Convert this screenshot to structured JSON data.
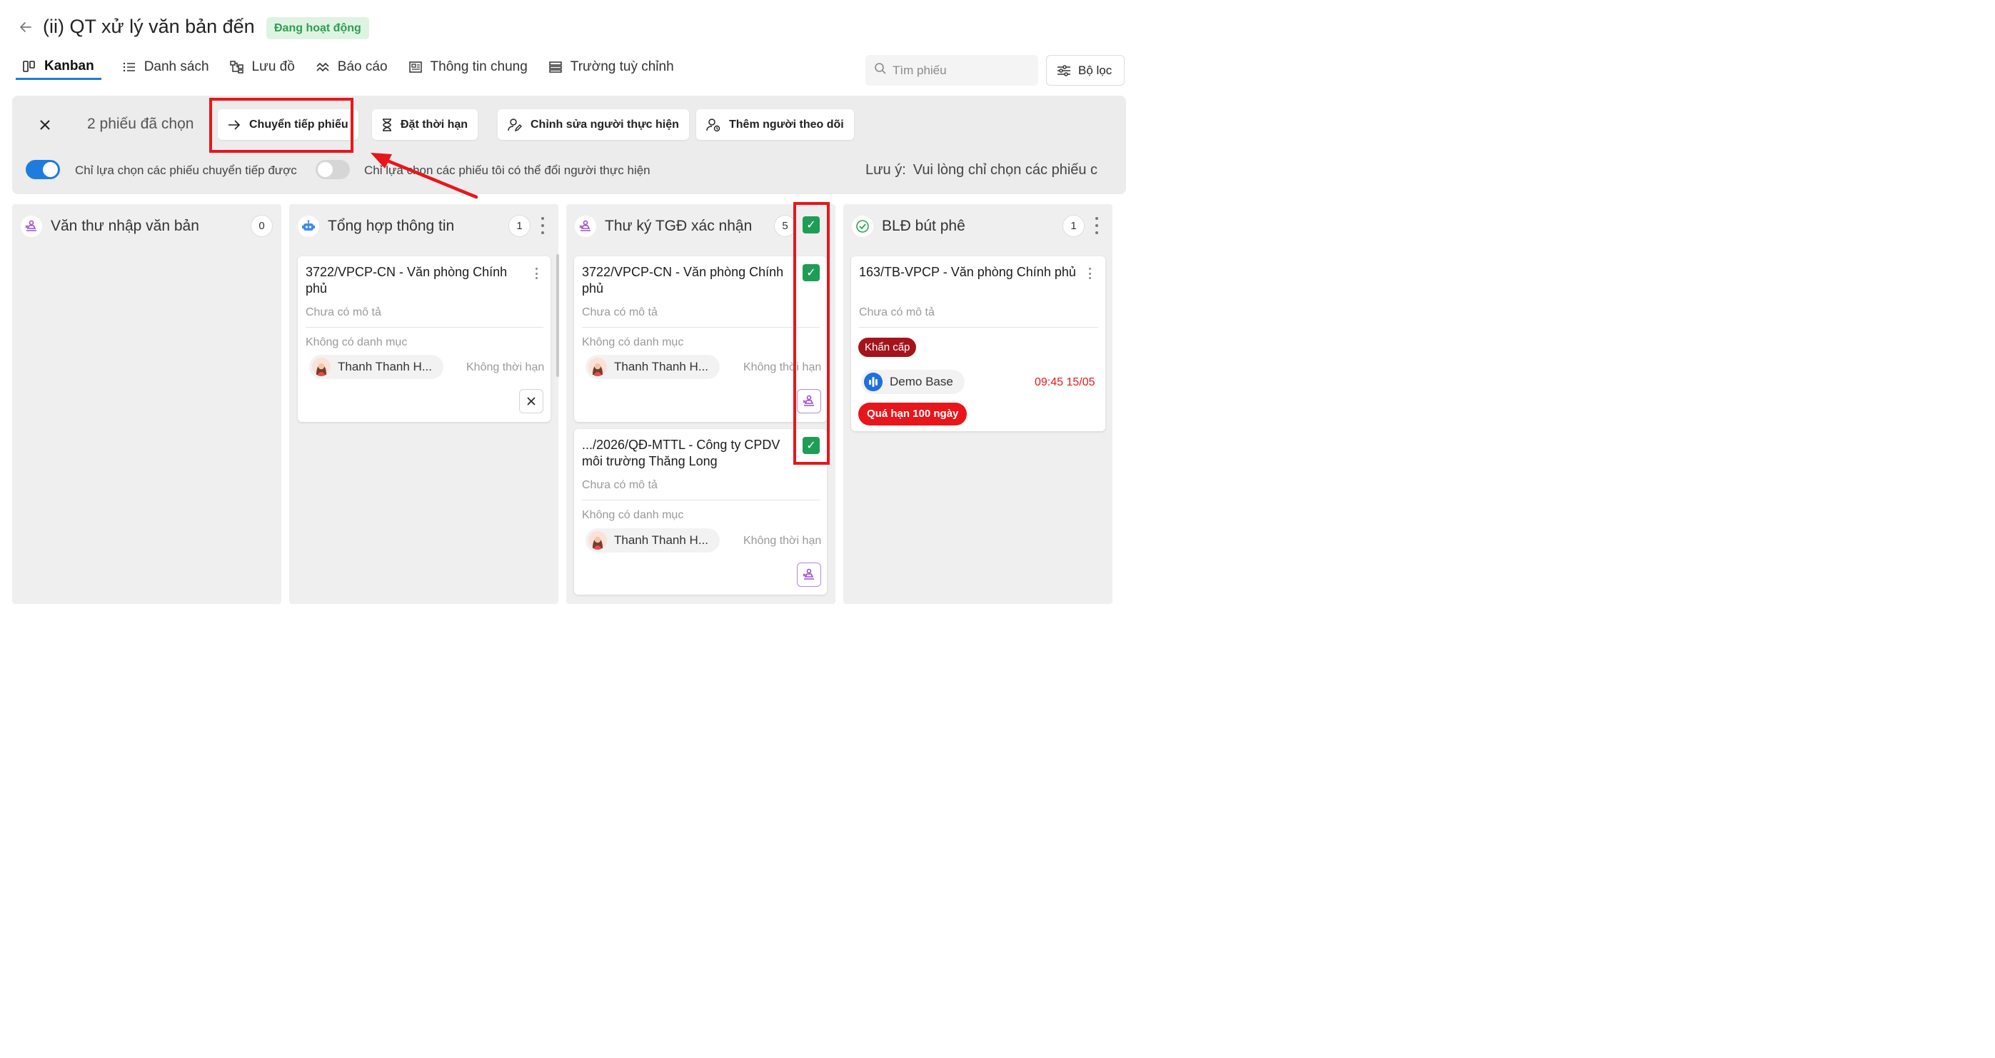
{
  "header": {
    "title": "(ii) QT xử lý văn bản đến",
    "status": "Đang hoạt động",
    "colors": {
      "status_bg": "#dff3e3",
      "status_text": "#2e9e4f",
      "accent": "#1e7be0",
      "highlight": "#e8161b"
    }
  },
  "tabs": [
    {
      "label": "Kanban",
      "icon": "kanban-icon",
      "active": true
    },
    {
      "label": "Danh sách",
      "icon": "list-icon"
    },
    {
      "label": "Lưu đồ",
      "icon": "flowchart-icon"
    },
    {
      "label": "Báo cáo",
      "icon": "report-icon"
    },
    {
      "label": "Thông tin chung",
      "icon": "info-icon"
    },
    {
      "label": "Trường tuỳ chỉnh",
      "icon": "custom-fields-icon"
    }
  ],
  "search": {
    "placeholder": "Tìm phiếu",
    "value": ""
  },
  "filter": {
    "label": "Bộ lọc"
  },
  "selection": {
    "count_label": "2 phiếu đã chọn",
    "actions": {
      "forward": "Chuyển tiếp phiếu",
      "deadline": "Đặt thời hạn",
      "edit_assignee": "Chỉnh sửa người thực hiện",
      "add_follower": "Thêm người theo dõi"
    },
    "toggle_forwardable": {
      "label": "Chỉ lựa chọn các phiếu chuyển tiếp được",
      "on": true
    },
    "toggle_reassignable": {
      "label": "Chỉ lựa chọn các phiếu tôi có thể đổi người thực hiện",
      "on": false
    },
    "note_label": "Lưu ý:",
    "note_text": "Vui lòng chỉ chọn các phiếu c"
  },
  "columns": [
    {
      "title": "Văn thư nhập văn bản",
      "count": "0",
      "icon": "stamp-icon"
    },
    {
      "title": "Tổng hợp thông tin",
      "count": "1",
      "icon": "robot-icon"
    },
    {
      "title": "Thư ký TGĐ xác nhận",
      "count": "5",
      "icon": "stamp-icon"
    },
    {
      "title": "BLĐ bút phê",
      "count": "1",
      "icon": "check-circle-icon"
    }
  ],
  "cards": {
    "c1": {
      "title": "3722/VPCP-CN - Văn phòng Chính phủ",
      "description": "Chưa có mô tả",
      "category": "Không có danh mục",
      "assignee": "Thanh Thanh H...",
      "deadline": "Không thời hạn"
    },
    "c2": {
      "title": "3722/VPCP-CN - Văn phòng Chính phủ",
      "description": "Chưa có mô tả",
      "category": "Không có danh mục",
      "assignee": "Thanh Thanh H...",
      "deadline": "Không thời hạn",
      "selected": true
    },
    "c3": {
      "title": ".../2026/QĐ-MTTL - Công ty CPDV môi trường Thăng Long",
      "description": "Chưa có mô tả",
      "category": "Không có danh mục",
      "assignee": "Thanh Thanh H...",
      "deadline": "Không thời hạn",
      "selected": true
    },
    "c4": {
      "title": "163/TB-VPCP - Văn phòng Chính phủ",
      "description": "Chưa có mô tả",
      "priority": "Khẩn cấp",
      "assignee": "Demo Base",
      "deadline": "09:45 15/05",
      "overdue": "Quá hạn 100 ngày"
    }
  }
}
